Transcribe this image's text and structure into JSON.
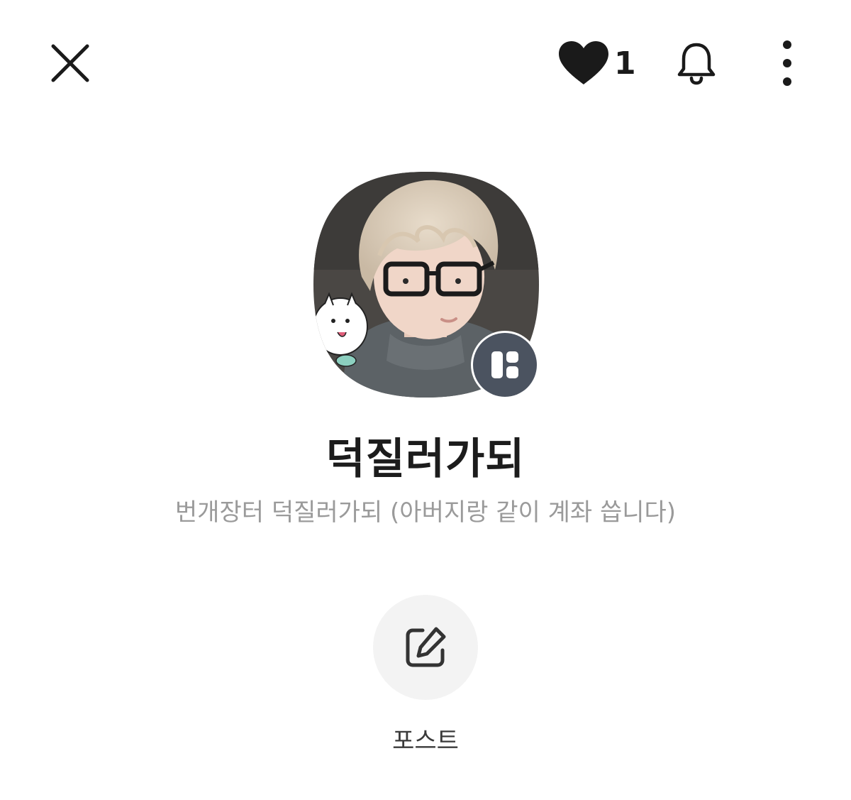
{
  "header": {
    "close_icon": "close-icon",
    "like_icon": "heart-icon",
    "like_count": "1",
    "bell_icon": "bell-icon",
    "more_icon": "more-vertical-icon"
  },
  "profile": {
    "avatar_badge_icon": "channel-grid-icon",
    "name": "덕질러가되",
    "description": "번개장터 덕질러가되 (아버지랑 같이 계좌 씁니다)"
  },
  "actions": {
    "post_icon": "edit-icon",
    "post_label": "포스트"
  },
  "colors": {
    "text_primary": "#1a1a1a",
    "text_secondary": "#9a9a9a",
    "badge_bg": "#4b5360",
    "button_bg": "#f3f3f3"
  }
}
